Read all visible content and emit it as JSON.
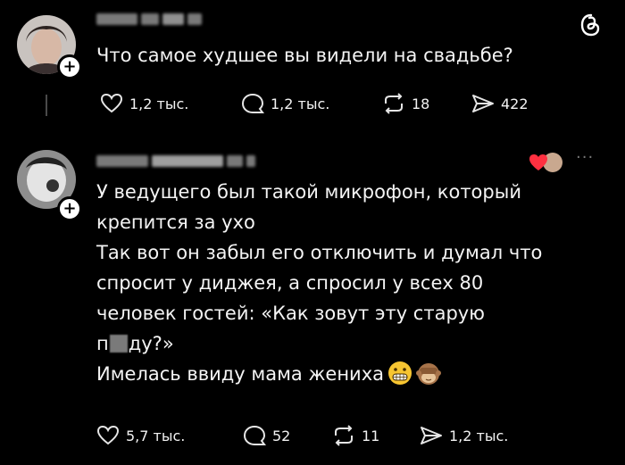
{
  "post": {
    "text": "Что самое худшее вы видели на свадьбе?",
    "stats": {
      "likes": "1,2 тыс.",
      "replies": "1,2 тыс.",
      "reposts": "18",
      "shares": "422"
    }
  },
  "reply": {
    "lines": [
      "У ведущего был такой микрофон, который",
      "крепится за ухо",
      "Так вот он забыл его отключить и думал что",
      "спросит у диджея, а спросил у всех 80",
      "человек гостей: «Как зовут эту старую"
    ],
    "censored_prefix": "п",
    "censored_suffix": "ду?»",
    "last_line": "Имелась ввиду мама жениха",
    "stats": {
      "likes": "5,7 тыс.",
      "replies": "52",
      "reposts": "11",
      "shares": "1,2 тыс."
    },
    "more": "···"
  },
  "icons": {
    "add": "+",
    "threads_logo": "threads-logo-icon",
    "heart": "heart-icon",
    "comment": "comment-icon",
    "repost": "repost-icon",
    "share": "share-icon"
  }
}
